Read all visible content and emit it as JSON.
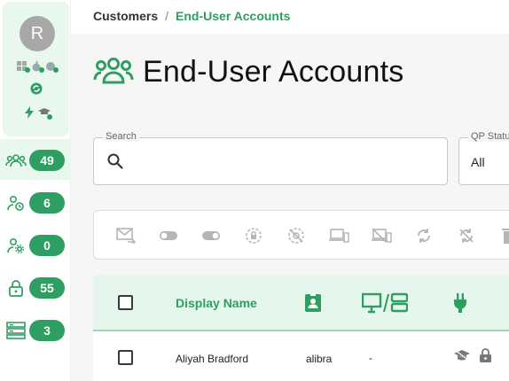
{
  "profile": {
    "initial": "R"
  },
  "sidebar": {
    "items": [
      {
        "icon": "users-group-icon",
        "count": "49"
      },
      {
        "icon": "user-clock-icon",
        "count": "6"
      },
      {
        "icon": "user-gear-icon",
        "count": "0"
      },
      {
        "icon": "lock-icon",
        "count": "55"
      },
      {
        "icon": "server-icon",
        "count": "3"
      }
    ]
  },
  "breadcrumb": {
    "parent": "Customers",
    "separator": "/",
    "current": "End-User Accounts"
  },
  "page": {
    "title": "End-User Accounts"
  },
  "search": {
    "label": "Search",
    "value": ""
  },
  "qp_status": {
    "label": "QP Status",
    "value": "All"
  },
  "toolbar": {
    "buttons": [
      "mail-forward-icon",
      "toggle-off-icon",
      "toggle-on-icon",
      "lock-clock-icon",
      "eye-off-icon",
      "devices-icon",
      "device-off-icon",
      "sync-icon",
      "sync-off-icon",
      "trash-icon"
    ]
  },
  "table": {
    "columns": {
      "display_name": "Display Name"
    },
    "rows": [
      {
        "display_name": "Aliyah Bradford",
        "login": "alibra",
        "device": "-"
      }
    ]
  },
  "colors": {
    "accent": "#2e9e62",
    "accent_light": "#e5f6ec"
  }
}
